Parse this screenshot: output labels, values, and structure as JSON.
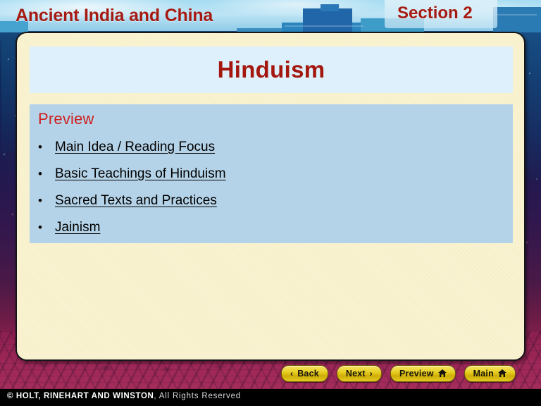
{
  "header": {
    "course_title": "Ancient India and China",
    "section_label": "Section 2",
    "title_color": "#a51b13"
  },
  "slide": {
    "title": "Hinduism",
    "title_color": "#a4170f",
    "panel_color": "#faf3d2",
    "title_band_color": "#ddf0fb"
  },
  "preview": {
    "heading": "Preview",
    "heading_color": "#cc2020",
    "box_color": "#b5d3e8",
    "bullet_glyph": "•",
    "items": [
      {
        "label": "Main Idea / Reading Focus"
      },
      {
        "label": "Basic Teachings of Hinduism"
      },
      {
        "label": "Sacred Texts and Practices"
      },
      {
        "label": "Jainism"
      }
    ]
  },
  "nav": {
    "back_label": "Back",
    "next_label": "Next",
    "preview_label": "Preview",
    "main_label": "Main",
    "back_chevron": "‹",
    "next_chevron": "›",
    "home_glyph": "⌂",
    "button_color": "#e8cf24"
  },
  "footer": {
    "copyright_symbol": "©",
    "publisher": "HOLT, RINEHART AND WINSTON",
    "rights": ", All Rights Reserved"
  }
}
